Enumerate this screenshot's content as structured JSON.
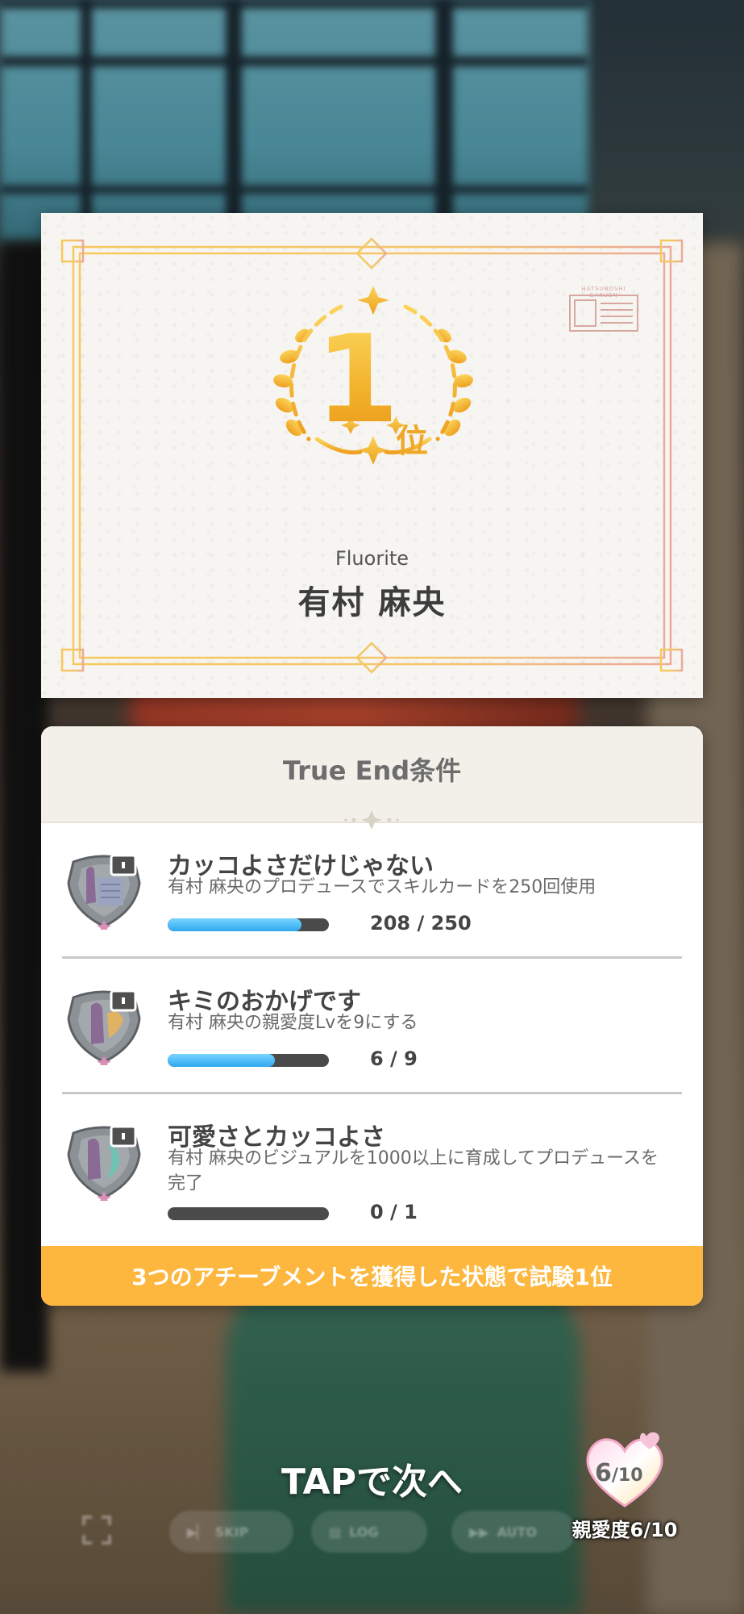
{
  "certificate": {
    "rank_number": "1",
    "rank_unit": "位",
    "unit_name": "Fluorite",
    "idol_name": "有村 麻央",
    "stamp_label": "HATSUBOSHI GAKUEN"
  },
  "conditions": {
    "title": "True End条件",
    "items": [
      {
        "title": "カッコよさだけじゃない",
        "description": "有村 麻央のプロデュースでスキルカードを250回使用",
        "progress_text": "208 / 250",
        "progress_fraction": 0.832,
        "locked": true
      },
      {
        "title": "キミのおかげです",
        "description": "有村 麻央の親愛度Lvを9にする",
        "progress_text": "6 / 9",
        "progress_fraction": 0.667,
        "locked": true
      },
      {
        "title": "可愛さとカッコよさ",
        "description": "有村 麻央のビジュアルを1000以上に育成してプロデュースを完了",
        "progress_text": "0 / 1",
        "progress_fraction": 0,
        "locked": true
      }
    ],
    "footer": "3つのアチーブメントを獲得した状態で試験1位"
  },
  "bottom": {
    "tap_prompt": "TAPで次へ",
    "controls": [
      "SKIP",
      "LOG",
      "AUTO"
    ],
    "affection_value": "6",
    "affection_max": "/10",
    "affection_label": "親愛度6/10"
  },
  "colors": {
    "gold": "#f2b12a",
    "footer_orange": "#fdb73e",
    "progress_blue": "#2fa8f0"
  }
}
